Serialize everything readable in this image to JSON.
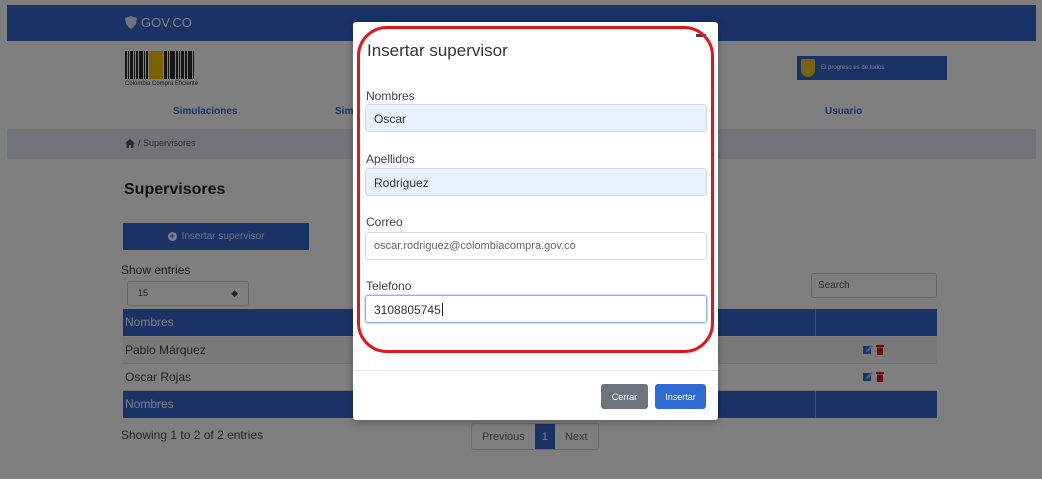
{
  "header": {
    "gov_logo": "GOV.CO",
    "brand_caption": "Colombia Compra Eficiente",
    "partner_text": "El progreso es de todos",
    "nav_items": [
      "Simulaciones",
      "Sim",
      "Usuario"
    ]
  },
  "breadcrumb": {
    "path": "/ Supervisores"
  },
  "main": {
    "page_title": "Supervisores",
    "insert_button": "Insertar supervisor",
    "show_entries_label": "Show entries",
    "entries_value": "15",
    "search_placeholder": "Search",
    "table": {
      "header": "Nombres",
      "rows": [
        "Pablo Márquez",
        "Oscar Rojas"
      ],
      "footer": "Nombres"
    },
    "showing_text": "Showing 1 to 2 of 2 entries",
    "pagination": {
      "previous": "Previous",
      "current": "1",
      "next": "Next"
    }
  },
  "modal": {
    "title": "Insertar supervisor",
    "fields": [
      {
        "label": "Nombres",
        "value": "Oscar"
      },
      {
        "label": "Apellidos",
        "value": "Rodriguez"
      },
      {
        "label": "Correo",
        "value": "oscar.rodriguez@colombiacompra.gov.co"
      },
      {
        "label": "Telefono",
        "value": "3108805745"
      }
    ],
    "cerrar_label": "Cerrar",
    "insertar_label": "Insertar"
  },
  "colors": {
    "brand_blue": "#3366cc",
    "annotation_red": "#e5141b"
  },
  "icons": [
    "shield-icon",
    "home-icon",
    "plus-circle-icon",
    "chevron-down-icon",
    "edit-icon",
    "trash-icon",
    "close-icon"
  ]
}
